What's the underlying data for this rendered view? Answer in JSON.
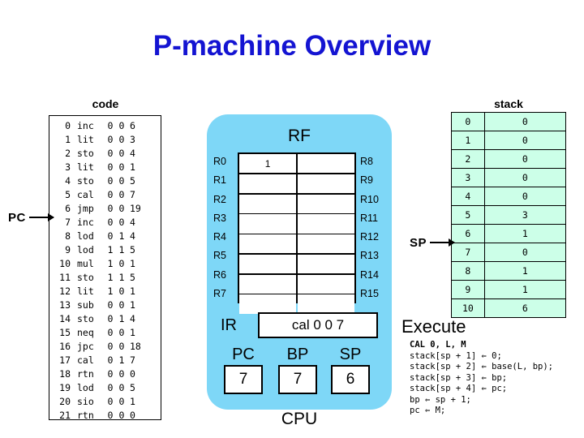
{
  "title": "P-machine Overview",
  "colors": {
    "title": "#1414d2",
    "cpu_panel": "#7ed7f7",
    "stack_cell": "#ccffe8",
    "background": "#ffffff"
  },
  "code": {
    "label": "code",
    "pointer": {
      "label": "PC",
      "target_row": 7
    },
    "columns": [
      "addr",
      "op",
      "f1",
      "f2",
      "f3"
    ],
    "rows": [
      {
        "addr": "0",
        "op": "inc",
        "f1": "0",
        "f2": "0",
        "f3": "6"
      },
      {
        "addr": "1",
        "op": "lit",
        "f1": "0",
        "f2": "0",
        "f3": "3"
      },
      {
        "addr": "2",
        "op": "sto",
        "f1": "0",
        "f2": "0",
        "f3": "4"
      },
      {
        "addr": "3",
        "op": "lit",
        "f1": "0",
        "f2": "0",
        "f3": "1"
      },
      {
        "addr": "4",
        "op": "sto",
        "f1": "0",
        "f2": "0",
        "f3": "5"
      },
      {
        "addr": "5",
        "op": "cal",
        "f1": "0",
        "f2": "0",
        "f3": "7"
      },
      {
        "addr": "6",
        "op": "jmp",
        "f1": "0",
        "f2": "0",
        "f3": "19"
      },
      {
        "addr": "7",
        "op": "inc",
        "f1": "0",
        "f2": "0",
        "f3": "4"
      },
      {
        "addr": "8",
        "op": "lod",
        "f1": "0",
        "f2": "1",
        "f3": "4"
      },
      {
        "addr": "9",
        "op": "lod",
        "f1": "1",
        "f2": "1",
        "f3": "5"
      },
      {
        "addr": "10",
        "op": "mul",
        "f1": "1",
        "f2": "0",
        "f3": "1"
      },
      {
        "addr": "11",
        "op": "sto",
        "f1": "1",
        "f2": "1",
        "f3": "5"
      },
      {
        "addr": "12",
        "op": "lit",
        "f1": "1",
        "f2": "0",
        "f3": "1"
      },
      {
        "addr": "13",
        "op": "sub",
        "f1": "0",
        "f2": "0",
        "f3": "1"
      },
      {
        "addr": "14",
        "op": "sto",
        "f1": "0",
        "f2": "1",
        "f3": "4"
      },
      {
        "addr": "15",
        "op": "neq",
        "f1": "0",
        "f2": "0",
        "f3": "1"
      },
      {
        "addr": "16",
        "op": "jpc",
        "f1": "0",
        "f2": "0",
        "f3": "18"
      },
      {
        "addr": "17",
        "op": "cal",
        "f1": "0",
        "f2": "1",
        "f3": "7"
      },
      {
        "addr": "18",
        "op": "rtn",
        "f1": "0",
        "f2": "0",
        "f3": "0"
      },
      {
        "addr": "19",
        "op": "lod",
        "f1": "0",
        "f2": "0",
        "f3": "5"
      },
      {
        "addr": "20",
        "op": "sio",
        "f1": "0",
        "f2": "0",
        "f3": "1"
      },
      {
        "addr": "21",
        "op": "rtn",
        "f1": "0",
        "f2": "0",
        "f3": "0"
      }
    ]
  },
  "cpu": {
    "caption": "CPU",
    "rf": {
      "title": "RF",
      "left_names": [
        "R0",
        "R1",
        "R2",
        "R3",
        "R4",
        "R5",
        "R6",
        "R7"
      ],
      "right_names": [
        "R8",
        "R9",
        "R10",
        "R11",
        "R12",
        "R13",
        "R14",
        "R15"
      ],
      "left_values": [
        "1",
        "",
        "",
        "",
        "",
        "",
        "",
        ""
      ],
      "right_values": [
        "",
        "",
        "",
        "",
        "",
        "",
        "",
        ""
      ]
    },
    "ir": {
      "label": "IR",
      "value": "cal 0 0 7"
    },
    "registers": [
      {
        "label": "PC",
        "value": "7"
      },
      {
        "label": "BP",
        "value": "7"
      },
      {
        "label": "SP",
        "value": "6"
      }
    ]
  },
  "stack": {
    "label": "stack",
    "pointer": {
      "label": "SP",
      "target_row": 6
    },
    "rows": [
      {
        "index": "0",
        "value": "0"
      },
      {
        "index": "1",
        "value": "0"
      },
      {
        "index": "2",
        "value": "0"
      },
      {
        "index": "3",
        "value": "0"
      },
      {
        "index": "4",
        "value": "0"
      },
      {
        "index": "5",
        "value": "3"
      },
      {
        "index": "6",
        "value": "1"
      },
      {
        "index": "7",
        "value": "0"
      },
      {
        "index": "8",
        "value": "1"
      },
      {
        "index": "9",
        "value": "1"
      },
      {
        "index": "10",
        "value": "6"
      }
    ]
  },
  "execute": {
    "label": "Execute",
    "heading": "CAL 0, L, M",
    "lines": [
      "stack[sp + 1] ⇐ 0;",
      "stack[sp + 2] ⇐ base(L, bp);",
      "stack[sp + 3] ⇐ bp;",
      "stack[sp + 4] ⇐ pc;",
      "bp ⇐ sp + 1;",
      "pc ⇐ M;"
    ]
  }
}
